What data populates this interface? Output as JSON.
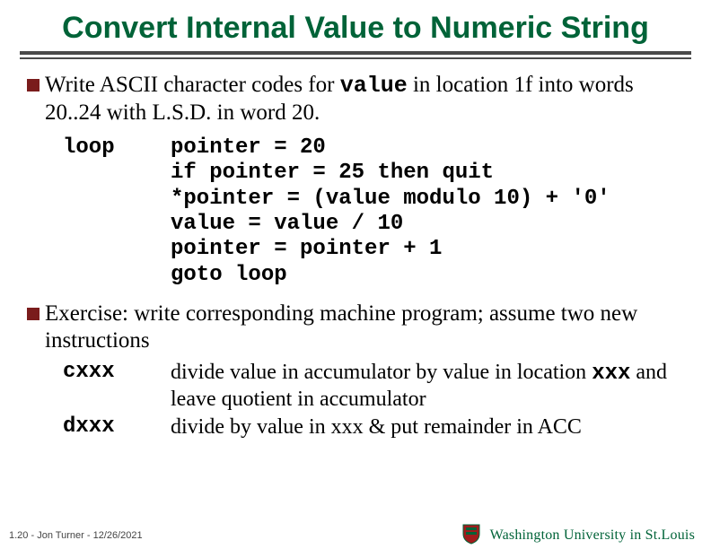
{
  "title": "Convert Internal Value to Numeric String",
  "bullets": {
    "b1": {
      "pre": "Write ASCII character codes for ",
      "codeword": "value",
      "post": " in location 1f into words 20..24 with L.S.D. in word 20."
    },
    "b2": "Exercise: write corresponding machine program;  assume two new instructions"
  },
  "code": {
    "label": "loop",
    "lines": [
      "pointer = 20",
      "if pointer = 25 then quit",
      "*pointer = (value modulo 10) + '0'",
      "value = value / 10",
      "pointer = pointer + 1",
      "goto loop"
    ]
  },
  "instructions": {
    "c": {
      "op": "cxxx",
      "desc_pre": "divide value in accumulator by value in location ",
      "desc_code": "xxx",
      "desc_post": " and leave quotient in accumulator"
    },
    "d": {
      "op": "dxxx",
      "desc": "divide by value in xxx & put remainder in ACC"
    }
  },
  "footer": {
    "page": "1.20",
    "author": "Jon Turner",
    "date": "12/26/2021",
    "university": "Washington University in St.Louis"
  }
}
